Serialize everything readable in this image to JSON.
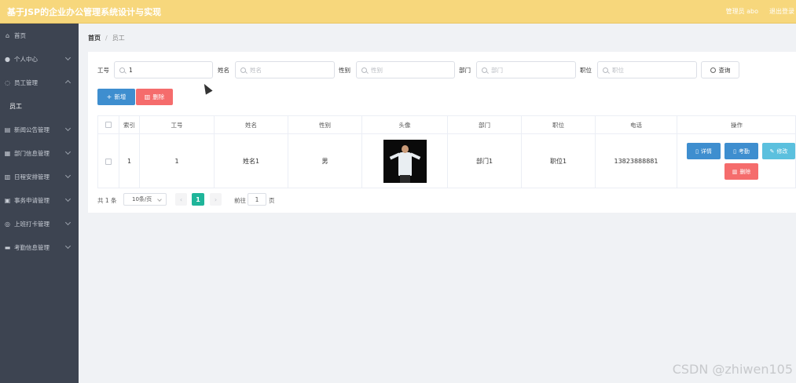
{
  "app": {
    "title": "基于JSP的企业办公管理系统设计与实现"
  },
  "topbar": {
    "admin_label": "管理员 abo",
    "logout_label": "退出登录"
  },
  "sidebar": {
    "items": [
      {
        "label": "首页",
        "icon": "home-icon"
      },
      {
        "label": "个人中心",
        "icon": "user-icon"
      },
      {
        "label": "员工管理",
        "icon": "employee-icon"
      },
      {
        "label": "新闻公告管理",
        "icon": "news-icon"
      },
      {
        "label": "部门信息管理",
        "icon": "department-icon"
      },
      {
        "label": "日程安排管理",
        "icon": "calendar-icon"
      },
      {
        "label": "事务申请管理",
        "icon": "affairs-icon"
      },
      {
        "label": "上班打卡管理",
        "icon": "clock-icon"
      },
      {
        "label": "考勤信息管理",
        "icon": "attendance-icon"
      }
    ],
    "sub_item": "员工"
  },
  "breadcrumb": {
    "home": "首页",
    "separator": "/",
    "current": "员工"
  },
  "search": {
    "job_no": {
      "label": "工号",
      "value": "1"
    },
    "name": {
      "label": "姓名",
      "placeholder": "姓名"
    },
    "gender": {
      "label": "性别",
      "placeholder": "性别"
    },
    "dept": {
      "label": "部门",
      "placeholder": "部门"
    },
    "position": {
      "label": "职位",
      "placeholder": "职位"
    },
    "query_label": "查询"
  },
  "actions": {
    "add_label": "新增",
    "delete_label": "删除"
  },
  "table": {
    "columns": [
      "索引",
      "工号",
      "姓名",
      "性别",
      "头像",
      "部门",
      "职位",
      "电话",
      "操作"
    ],
    "rows": [
      {
        "index": "1",
        "job_no": "1",
        "name": "姓名1",
        "gender": "男",
        "dept": "部门1",
        "position": "职位1",
        "phone": "13823888881"
      }
    ],
    "row_actions": {
      "detail": "详情",
      "attendance": "考勤",
      "edit": "修改",
      "delete": "删除"
    }
  },
  "pagination": {
    "total": "共 1 条",
    "page_size": "10条/页",
    "current_page": "1",
    "goto_label": "前往",
    "goto_value": "1",
    "page_suffix": "页"
  },
  "watermark": "CSDN @zhiwen105",
  "colors": {
    "topbar": "#f7d77c",
    "sidebar": "#3d4451",
    "primary": "#3e8ecf",
    "danger": "#f56c6c",
    "info": "#5bc0de",
    "pager_active": "#1fb59a"
  }
}
